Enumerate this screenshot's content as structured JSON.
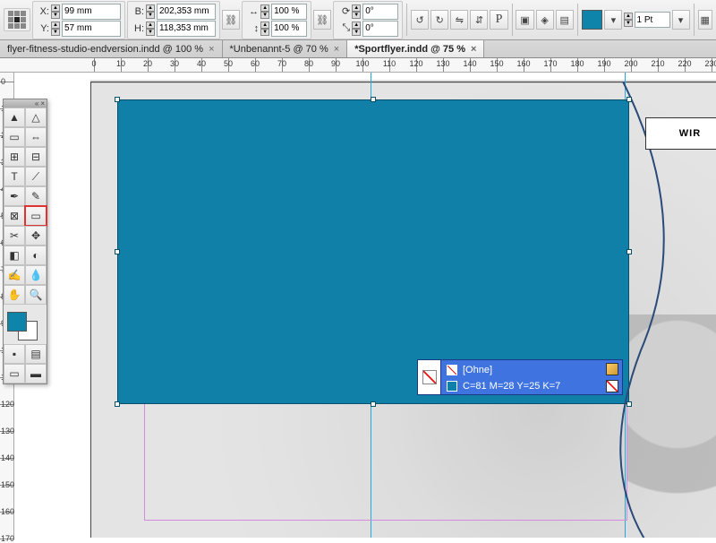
{
  "ctrl": {
    "x_label": "X:",
    "x": "99 mm",
    "y_label": "Y:",
    "y": "57 mm",
    "w_label": "B:",
    "w": "202,353 mm",
    "h_label": "H:",
    "h": "118,353 mm",
    "scale_x": "100 %",
    "scale_y": "100 %",
    "rot": "0°",
    "shear": "0°",
    "stroke_weight": "1 Pt",
    "fill_color": "#1080a8"
  },
  "tabs": [
    {
      "label": "flyer-fitness-studio-endversion.indd @ 100 %",
      "active": false
    },
    {
      "label": "*Unbenannt-5 @ 70 %",
      "active": false
    },
    {
      "label": "*Sportflyer.indd @ 75 %",
      "active": true
    }
  ],
  "ruler": {
    "start": 0,
    "end": 230,
    "step": 10
  },
  "toolbox": {
    "tools": [
      [
        "selection",
        "direct-select"
      ],
      [
        "page",
        "gap"
      ],
      [
        "content-grab",
        "content-place"
      ],
      [
        "type",
        "line"
      ],
      [
        "pen",
        "pencil"
      ],
      [
        "rectangle-frame",
        "rectangle"
      ],
      [
        "scissors",
        "free-transform"
      ],
      [
        "gradient-swatch",
        "gradient-feather"
      ],
      [
        "note",
        "eyedropper"
      ],
      [
        "hand",
        "zoom"
      ]
    ],
    "selected": "rectangle"
  },
  "swatch_panel": {
    "none_label": "[Ohne]",
    "cmyk_label": "C=81 M=28 Y=25 K=7"
  },
  "wir_text": "WIR",
  "guides": {
    "v1_mm": 99,
    "v2_mm": 198
  }
}
